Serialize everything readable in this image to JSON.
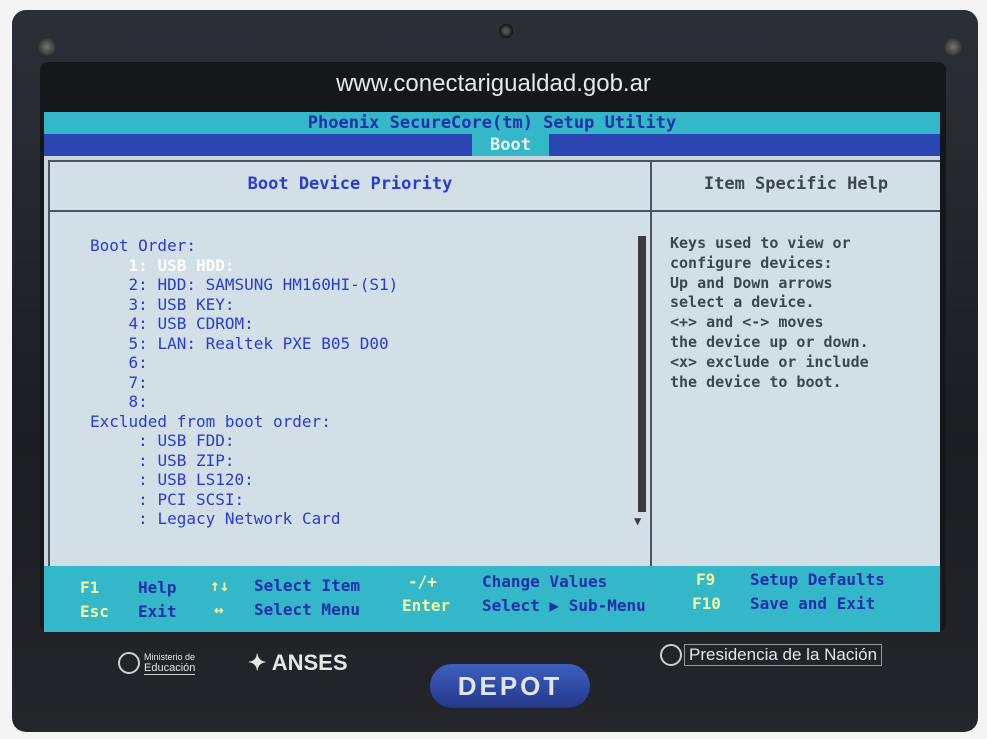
{
  "bezel": {
    "url": "www.conectarigualdad.gob.ar",
    "brand_left_1": "Ministerio de",
    "brand_left_2": "Educación",
    "anses": "ANSES",
    "presidencia": "Presidencia de la Nación",
    "depot": "DEPOT"
  },
  "bios": {
    "title": "Phoenix SecureCore(tm) Setup Utility",
    "active_menu": "Boot",
    "left_header": "Boot Device Priority",
    "right_header": "Item Specific Help",
    "boot_order_label": "Boot Order:",
    "boot_order": [
      {
        "num": "1:",
        "name": "USB HDD:"
      },
      {
        "num": "2:",
        "name": "HDD: SAMSUNG HM160HI-(S1)"
      },
      {
        "num": "3:",
        "name": "USB KEY:"
      },
      {
        "num": "4:",
        "name": "USB CDROM:"
      },
      {
        "num": "5:",
        "name": "LAN: Realtek PXE B05 D00"
      },
      {
        "num": "6:",
        "name": ""
      },
      {
        "num": "7:",
        "name": ""
      },
      {
        "num": "8:",
        "name": ""
      }
    ],
    "selected_index": 0,
    "excluded_label": "Excluded from boot order:",
    "excluded": [
      {
        "num": ":",
        "name": "USB FDD:"
      },
      {
        "num": ":",
        "name": "USB ZIP:"
      },
      {
        "num": ":",
        "name": "USB LS120:"
      },
      {
        "num": ":",
        "name": "PCI SCSI:"
      },
      {
        "num": ":",
        "name": "Legacy Network Card"
      }
    ],
    "help_lines": [
      "Keys used to view or",
      "configure devices:",
      "Up and Down arrows",
      "select a device.",
      "<+> and <-> moves",
      "the device up or down.",
      "<x> exclude or include",
      "the device to boot."
    ]
  },
  "footer": {
    "f1_key": "F1",
    "f1_label": "Help",
    "esc_key": "Esc",
    "esc_label": "Exit",
    "updown_key": "↑↓",
    "updown_label": "Select Item",
    "leftright_key": "↔",
    "leftright_label": "Select Menu",
    "plusminus_key": "-/+",
    "plusminus_label": "Change Values",
    "enter_key": "Enter",
    "enter_label": "Select ▶ Sub-Menu",
    "f9_key": "F9",
    "f9_label": "Setup Defaults",
    "f10_key": "F10",
    "f10_label": "Save and Exit"
  },
  "colors": {
    "bios_cyan": "#34b7c9",
    "bios_blue": "#2b45b2",
    "bios_text_blue": "#2a3ccf",
    "bios_panel": "#d2dfe6"
  }
}
